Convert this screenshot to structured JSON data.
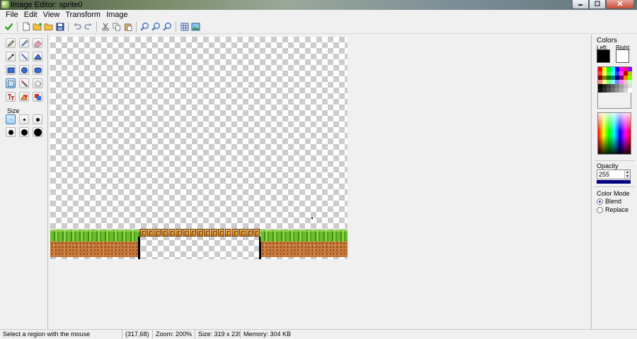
{
  "window": {
    "title": "Image Editor: sprite0"
  },
  "menu": {
    "items": [
      "File",
      "Edit",
      "View",
      "Transform",
      "Image"
    ]
  },
  "toolbar": {
    "buttons": [
      "checkmark-icon",
      "new-file-icon",
      "open-folder-icon",
      "open-folder-alt-icon",
      "save-icon",
      "undo-icon",
      "redo-icon",
      "cut-icon",
      "copy-icon",
      "paste-icon",
      "zoom-in-icon",
      "zoom-out-icon",
      "zoom-reset-icon",
      "grid-icon",
      "image-icon"
    ]
  },
  "tools": {
    "items": [
      "pencil",
      "spray",
      "eraser",
      "color-picker",
      "line",
      "fill-bucket",
      "rectangle",
      "ellipse",
      "rounded-rectangle",
      "select-rectangle",
      "magic-wand",
      "select-lasso",
      "text",
      "shape-fill",
      "color-replace"
    ],
    "size_label": "Size"
  },
  "colors": {
    "heading": "Colors",
    "left_label": "Left:",
    "right_label": "Right:",
    "left_color": "#000000",
    "right_color": "#ffffff",
    "palette": [
      "#ff0000",
      "#ffff00",
      "#00ff00",
      "#00ffff",
      "#0000ff",
      "#ff00ff",
      "#ff0080",
      "#8000ff",
      "#ff4040",
      "#ffff40",
      "#40ff40",
      "#40ffff",
      "#4040ff",
      "#ff40ff",
      "#c00000",
      "#c0c000",
      "#800000",
      "#808000",
      "#008000",
      "#008080",
      "#000080",
      "#800080",
      "#ff8000",
      "#80ff00",
      "#ff8080",
      "#ffff80",
      "#80ff80",
      "#80ffff",
      "#8080ff",
      "#ff80ff",
      "#ffc0c0",
      "#c0ffc0",
      "#000000",
      "#202020",
      "#404040",
      "#606060",
      "#808080",
      "#a0a0a0",
      "#c0c0c0",
      "#e0e0e0",
      "#101010",
      "#303030",
      "#505050",
      "#707070",
      "#909090",
      "#b0b0b0",
      "#d0d0d0",
      "#ffffff"
    ]
  },
  "opacity": {
    "label": "Opacity",
    "value": "255"
  },
  "color_mode": {
    "heading": "Color Mode",
    "options": [
      "Blend",
      "Replace"
    ],
    "selected": "Blend"
  },
  "status": {
    "hint": "Select a region with the mouse",
    "coords": "(317,68)",
    "zoom": "Zoom: 200%",
    "size": "Size: 319 x 239",
    "memory": "Memory: 304 KB"
  }
}
